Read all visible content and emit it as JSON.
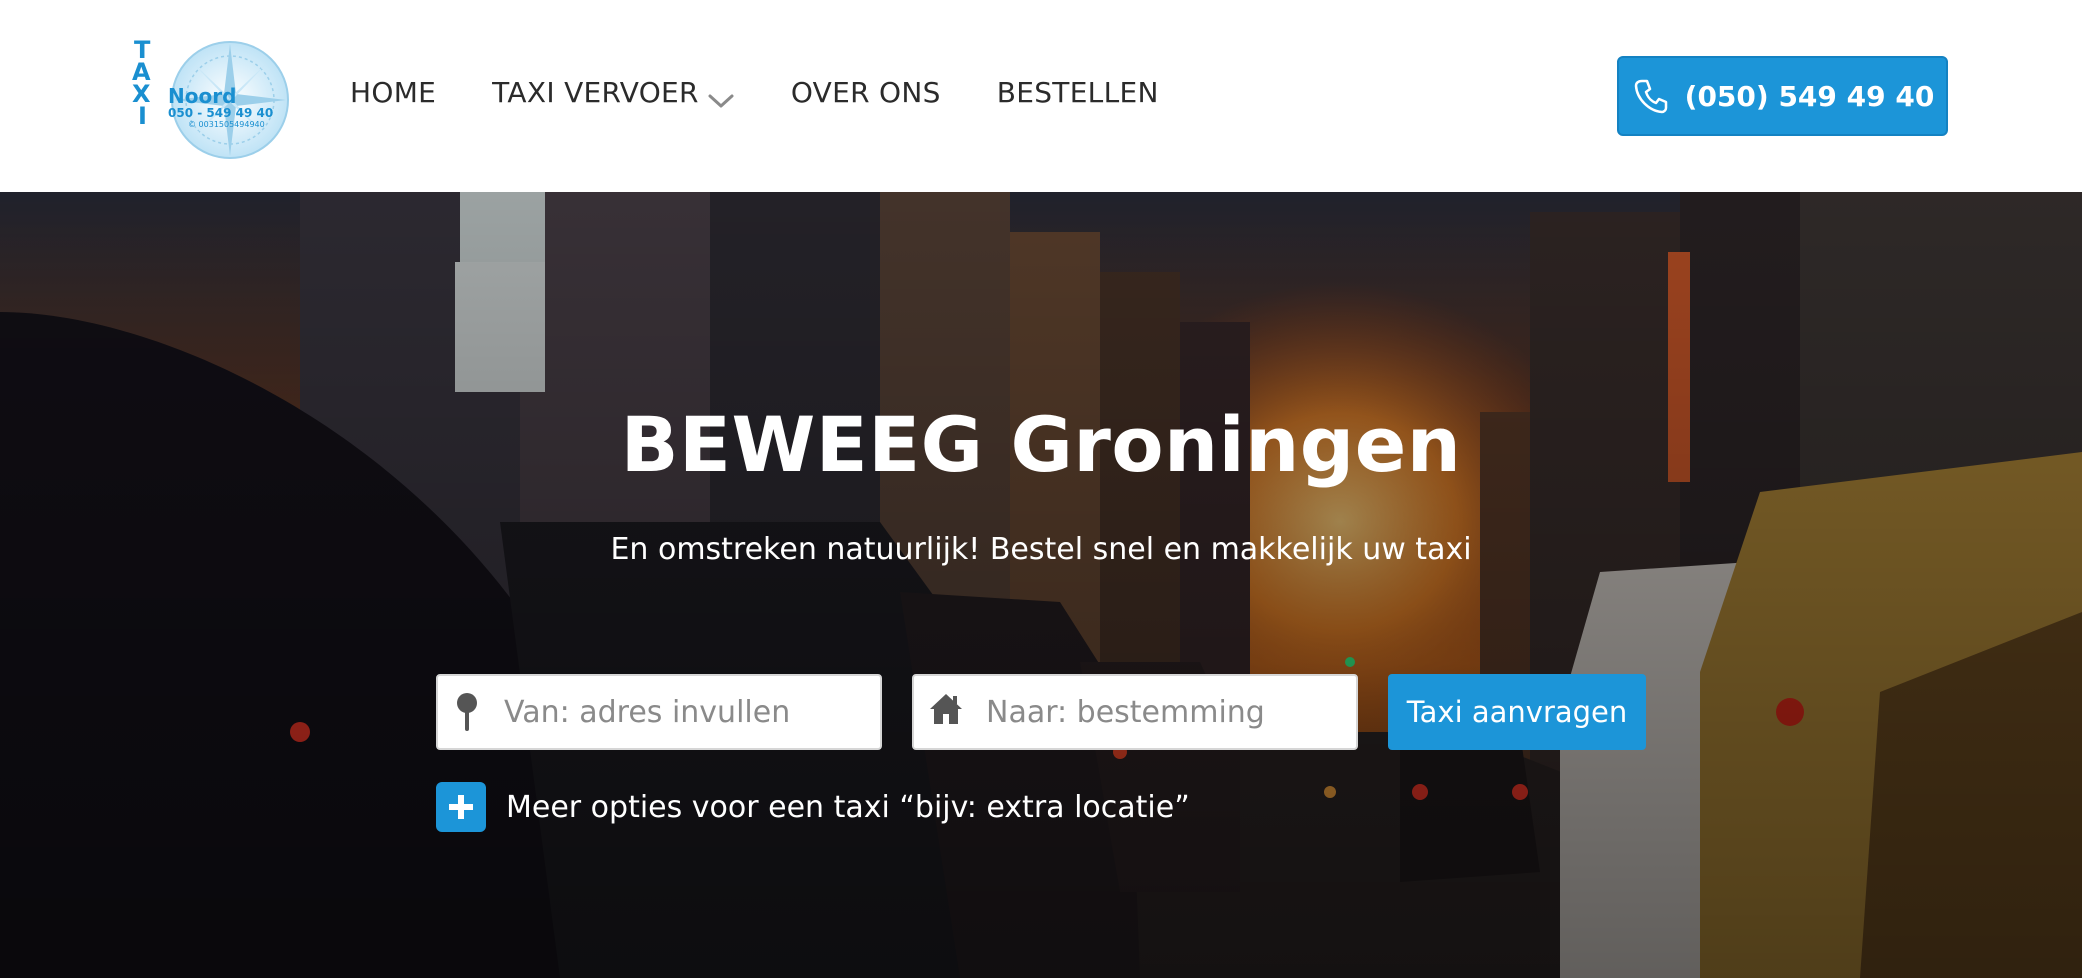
{
  "header": {
    "logo": {
      "letters": [
        "T",
        "A",
        "X",
        "I"
      ],
      "brand": "Noord",
      "phone_small": "050 - 549 49 40",
      "phone_tiny": "© 0031505494940"
    },
    "nav": [
      {
        "label": "HOME"
      },
      {
        "label": "TAXI VERVOER",
        "has_dropdown": true
      },
      {
        "label": "OVER ONS"
      },
      {
        "label": "BESTELLEN"
      }
    ],
    "phone_button": {
      "label": "(050) 549 49 40",
      "icon": "phone-icon"
    }
  },
  "hero": {
    "title": "BEWEEG Groningen",
    "subtitle": "En omstreken natuurlijk! Bestel snel en makkelijk uw taxi",
    "from_field": {
      "placeholder": "Van: adres invullen",
      "value": "",
      "icon": "map-pin-icon"
    },
    "to_field": {
      "placeholder": "Naar: bestemming",
      "value": "",
      "icon": "home-icon"
    },
    "submit_label": "Taxi aanvragen",
    "more_options_label": "Meer opties voor een taxi “bijv: extra locatie”"
  },
  "colors": {
    "accent": "#1c95d8",
    "nav_text": "#2b2b2b",
    "logo_blue": "#1a8fd0"
  }
}
